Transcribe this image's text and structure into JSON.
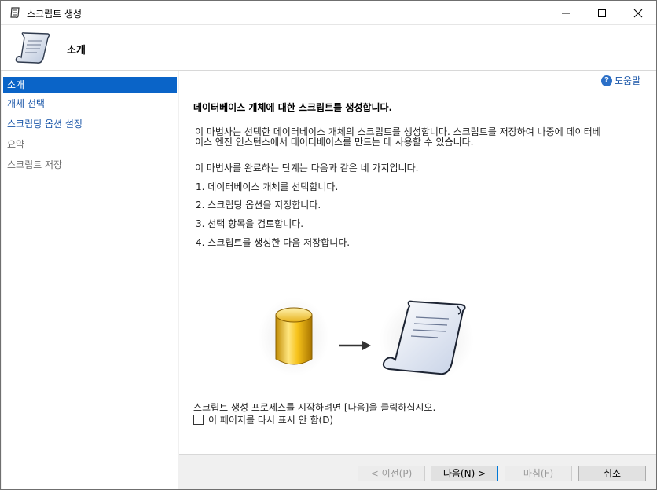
{
  "window": {
    "title": "스크립트 생성"
  },
  "header": {
    "title": "소개"
  },
  "sidebar": {
    "items": [
      {
        "label": "소개",
        "state": "active"
      },
      {
        "label": "개체 선택",
        "state": "link"
      },
      {
        "label": "스크립팅 옵션 설정",
        "state": "link"
      },
      {
        "label": "요약",
        "state": "disabled"
      },
      {
        "label": "스크립트 저장",
        "state": "disabled"
      }
    ]
  },
  "content": {
    "help_label": "도움말",
    "heading": "데이터베이스 개체에 대한 스크립트를 생성합니다.",
    "description_line1": "이 마법사는 선택한 데이터베이스 개체의 스크립트를 생성합니다. 스크립트를 저장하여 나중에 데이터베",
    "description_line2": "이스 엔진 인스턴스에서 데이터베이스를 만드는 데 사용할 수 있습니다.",
    "steps_intro": "이 마법사를 완료하는 단계는 다음과 같은 네 가지입니다.",
    "steps": [
      "1. 데이터베이스 개체를 선택합니다.",
      "2. 스크립팅 옵션을 지정합니다.",
      "3. 선택 항목을 검토합니다.",
      "4. 스크립트를 생성한 다음 저장합니다."
    ],
    "start_text": "스크립트 생성 프로세스를 시작하려면 [다음]을 클릭하십시오.",
    "checkbox_label": "이 페이지를 다시 표시 안 함(D)",
    "checkbox_checked": false
  },
  "footer": {
    "prev": "< 이전(P)",
    "next": "다음(N) >",
    "finish": "마침(F)",
    "cancel": "취소"
  },
  "colors": {
    "accent": "#0a64c8",
    "link": "#1a56a8"
  }
}
